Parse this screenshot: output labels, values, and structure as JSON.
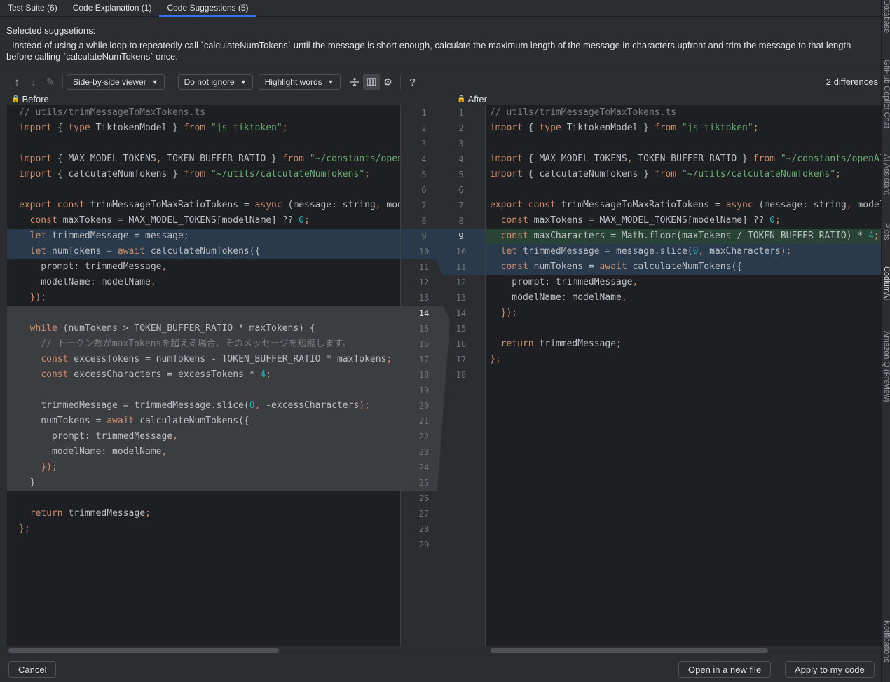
{
  "tabs": [
    {
      "label": "Test Suite (6)"
    },
    {
      "label": "Code Explanation (1)"
    },
    {
      "label": "Code Suggestions (5)"
    }
  ],
  "description": {
    "title": "Selected suggsetions:",
    "body": " - Instead of using a while loop to repeatedly call `calculateNumTokens` until the message is short enough, calculate the maximum length of the message in characters upfront and trim the message to that length before calling `calculateNumTokens` once."
  },
  "toolbar": {
    "viewer": "Side-by-side viewer",
    "ignore": "Do not ignore",
    "highlight": "Highlight words",
    "help": "?",
    "diff_count": "2 differences"
  },
  "before": {
    "label": "Before",
    "lines": [
      "// utils/trimMessageToMaxTokens.ts",
      "import { type TiktokenModel } from \"js-tiktoken\";",
      "",
      "import { MAX_MODEL_TOKENS, TOKEN_BUFFER_RATIO } from \"~/constants/openAI\";",
      "import { calculateNumTokens } from \"~/utils/calculateNumTokens\";",
      "",
      "export const trimMessageToMaxRatioTokens = async (message: string, model",
      "  const maxTokens = MAX_MODEL_TOKENS[modelName] ?? 0;",
      "  let trimmedMessage = message;",
      "  let numTokens = await calculateNumTokens({",
      "    prompt: trimmedMessage,",
      "    modelName: modelName,",
      "  });",
      "",
      "  while (numTokens > TOKEN_BUFFER_RATIO * maxTokens) {",
      "    // トークン数がmaxTokensを超える場合、そのメッセージを短縮します。",
      "    const excessTokens = numTokens - TOKEN_BUFFER_RATIO * maxTokens;",
      "    const excessCharacters = excessTokens * 4;",
      "",
      "    trimmedMessage = trimmedMessage.slice(0, -excessCharacters);",
      "    numTokens = await calculateNumTokens({",
      "      prompt: trimmedMessage,",
      "      modelName: modelName,",
      "    });",
      "  }",
      "",
      "  return trimmedMessage;",
      "};",
      ""
    ]
  },
  "after": {
    "label": "After",
    "lines": [
      "// utils/trimMessageToMaxTokens.ts",
      "import { type TiktokenModel } from \"js-tiktoken\";",
      "",
      "import { MAX_MODEL_TOKENS, TOKEN_BUFFER_RATIO } from \"~/constants/openAI\";",
      "import { calculateNumTokens } from \"~/utils/calculateNumTokens\";",
      "",
      "export const trimMessageToMaxRatioTokens = async (message: string, modelName",
      "  const maxTokens = MAX_MODEL_TOKENS[modelName] ?? 0;",
      "  const maxCharacters = Math.floor(maxTokens / TOKEN_BUFFER_RATIO) * 4;",
      "  let trimmedMessage = message.slice(0, maxCharacters);",
      "  const numTokens = await calculateNumTokens({",
      "    prompt: trimmedMessage,",
      "    modelName: modelName,",
      "  });",
      "",
      "  return trimmedMessage;",
      "};",
      ""
    ]
  },
  "footer": {
    "cancel": "Cancel",
    "open_new": "Open in a new file",
    "apply": "Apply to my code"
  },
  "rail": [
    "Database",
    "GitHub Copilot Chat",
    "AI Assistant",
    "Plots",
    "CodiumAI",
    "Amazon Q (Preview)",
    "Notifications"
  ]
}
